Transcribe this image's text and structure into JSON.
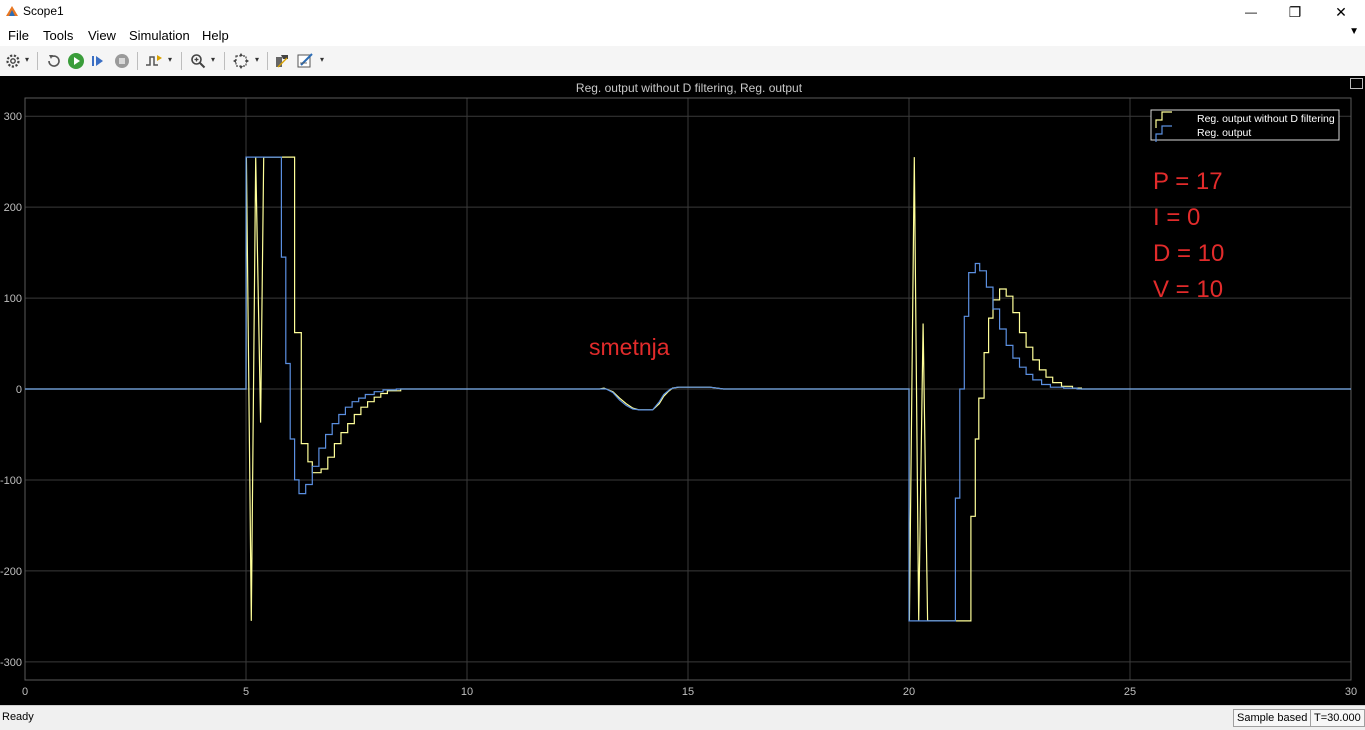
{
  "window": {
    "title": "Scope1",
    "minimize_glyph": "—",
    "maximize_glyph": "❐",
    "close_glyph": "✕"
  },
  "menu": {
    "items": [
      "File",
      "Tools",
      "View",
      "Simulation",
      "Help"
    ],
    "overflow_glyph": "▼"
  },
  "toolbar": {
    "buttons": [
      "settings-icon",
      "restore-icon",
      "run-icon",
      "step-forward-icon",
      "stop-icon",
      "triggers-icon",
      "zoom-in-icon",
      "fit-to-view-icon",
      "cursor-measurements-icon",
      "style-icon"
    ],
    "dropdown_glyph": "▾"
  },
  "scope": {
    "background": "#000000",
    "grid_color": "#3a3a3a",
    "axis_color": "#bfbfbf"
  },
  "chart_data": {
    "type": "line",
    "title": "Reg. output without D filtering, Reg. output",
    "xlabel": "",
    "ylabel": "",
    "xlim": [
      0,
      30
    ],
    "ylim": [
      -320,
      320
    ],
    "xticks": [
      0,
      5,
      10,
      15,
      20,
      25,
      30
    ],
    "yticks": [
      300,
      200,
      100,
      0,
      -100,
      -200,
      -300
    ],
    "grid": true,
    "legend_position": "top-right",
    "series": [
      {
        "name": "Reg. output without D filtering",
        "color": "#ffff99",
        "step": true,
        "points": [
          [
            0,
            0
          ],
          [
            5,
            0
          ],
          [
            5.01,
            255
          ],
          [
            5.12,
            -255
          ],
          [
            5.22,
            255
          ],
          [
            5.33,
            -37
          ],
          [
            5.4,
            255
          ],
          [
            6.1,
            255
          ],
          [
            6.1,
            62
          ],
          [
            6.25,
            62
          ],
          [
            6.25,
            -60
          ],
          [
            6.4,
            -60
          ],
          [
            6.4,
            -80
          ],
          [
            6.5,
            -80
          ],
          [
            6.5,
            -92
          ],
          [
            6.7,
            -92
          ],
          [
            6.7,
            -88
          ],
          [
            6.85,
            -88
          ],
          [
            6.85,
            -75
          ],
          [
            7,
            -75
          ],
          [
            7,
            -60
          ],
          [
            7.15,
            -60
          ],
          [
            7.15,
            -48
          ],
          [
            7.3,
            -48
          ],
          [
            7.3,
            -38
          ],
          [
            7.45,
            -38
          ],
          [
            7.45,
            -28
          ],
          [
            7.6,
            -28
          ],
          [
            7.6,
            -20
          ],
          [
            7.75,
            -20
          ],
          [
            7.75,
            -14
          ],
          [
            7.9,
            -14
          ],
          [
            7.9,
            -9
          ],
          [
            8.05,
            -9
          ],
          [
            8.05,
            -5
          ],
          [
            8.2,
            -5
          ],
          [
            8.2,
            -2
          ],
          [
            8.5,
            -2
          ],
          [
            8.5,
            0
          ],
          [
            13,
            0
          ],
          [
            13.1,
            1
          ],
          [
            13.3,
            -3
          ],
          [
            13.45,
            -10
          ],
          [
            13.6,
            -16
          ],
          [
            13.75,
            -21
          ],
          [
            13.9,
            -23
          ],
          [
            14.2,
            -23
          ],
          [
            14.35,
            -16
          ],
          [
            14.45,
            -8
          ],
          [
            14.55,
            -3
          ],
          [
            14.65,
            1
          ],
          [
            14.8,
            2
          ],
          [
            15.5,
            2
          ],
          [
            15.8,
            0
          ],
          [
            20,
            0
          ],
          [
            20.01,
            -255
          ],
          [
            20.12,
            255
          ],
          [
            20.22,
            -255
          ],
          [
            20.32,
            72
          ],
          [
            20.42,
            -255
          ],
          [
            21.4,
            -255
          ],
          [
            21.4,
            -140
          ],
          [
            21.5,
            -140
          ],
          [
            21.5,
            -55
          ],
          [
            21.58,
            -55
          ],
          [
            21.58,
            -10
          ],
          [
            21.7,
            -10
          ],
          [
            21.7,
            40
          ],
          [
            21.8,
            40
          ],
          [
            21.8,
            78
          ],
          [
            21.9,
            78
          ],
          [
            21.9,
            98
          ],
          [
            22.05,
            98
          ],
          [
            22.05,
            110
          ],
          [
            22.2,
            110
          ],
          [
            22.2,
            102
          ],
          [
            22.35,
            102
          ],
          [
            22.35,
            84
          ],
          [
            22.5,
            84
          ],
          [
            22.5,
            62
          ],
          [
            22.65,
            62
          ],
          [
            22.65,
            46
          ],
          [
            22.8,
            46
          ],
          [
            22.8,
            32
          ],
          [
            22.95,
            32
          ],
          [
            22.95,
            21
          ],
          [
            23.1,
            21
          ],
          [
            23.1,
            13
          ],
          [
            23.25,
            13
          ],
          [
            23.25,
            7
          ],
          [
            23.45,
            7
          ],
          [
            23.45,
            3
          ],
          [
            23.7,
            3
          ],
          [
            23.7,
            1
          ],
          [
            23.9,
            1
          ],
          [
            23.9,
            0
          ],
          [
            30,
            0
          ]
        ]
      },
      {
        "name": "Reg. output",
        "color": "#5b8fe0",
        "step": true,
        "points": [
          [
            0,
            0
          ],
          [
            5,
            0
          ],
          [
            5,
            255
          ],
          [
            5.8,
            255
          ],
          [
            5.8,
            145
          ],
          [
            5.9,
            145
          ],
          [
            5.9,
            28
          ],
          [
            6.0,
            28
          ],
          [
            6.0,
            -55
          ],
          [
            6.1,
            -55
          ],
          [
            6.1,
            -100
          ],
          [
            6.2,
            -100
          ],
          [
            6.2,
            -115
          ],
          [
            6.35,
            -115
          ],
          [
            6.35,
            -105
          ],
          [
            6.5,
            -105
          ],
          [
            6.5,
            -85
          ],
          [
            6.65,
            -85
          ],
          [
            6.65,
            -65
          ],
          [
            6.8,
            -65
          ],
          [
            6.8,
            -50
          ],
          [
            6.95,
            -50
          ],
          [
            6.95,
            -38
          ],
          [
            7.1,
            -38
          ],
          [
            7.1,
            -28
          ],
          [
            7.25,
            -28
          ],
          [
            7.25,
            -20
          ],
          [
            7.4,
            -20
          ],
          [
            7.4,
            -14
          ],
          [
            7.55,
            -14
          ],
          [
            7.55,
            -10
          ],
          [
            7.7,
            -10
          ],
          [
            7.7,
            -6
          ],
          [
            7.9,
            -6
          ],
          [
            7.9,
            -3
          ],
          [
            8.1,
            -3
          ],
          [
            8.1,
            -1
          ],
          [
            8.4,
            -1
          ],
          [
            8.4,
            0
          ],
          [
            13,
            0
          ],
          [
            13.15,
            0
          ],
          [
            13.3,
            -4
          ],
          [
            13.45,
            -12
          ],
          [
            13.6,
            -18
          ],
          [
            13.75,
            -22
          ],
          [
            13.9,
            -23
          ],
          [
            14.2,
            -23
          ],
          [
            14.35,
            -14
          ],
          [
            14.45,
            -6
          ],
          [
            14.6,
            0
          ],
          [
            14.75,
            2
          ],
          [
            15.5,
            2
          ],
          [
            15.8,
            0
          ],
          [
            20,
            0
          ],
          [
            20,
            -255
          ],
          [
            21.05,
            -255
          ],
          [
            21.05,
            -120
          ],
          [
            21.15,
            -120
          ],
          [
            21.15,
            0
          ],
          [
            21.25,
            0
          ],
          [
            21.25,
            80
          ],
          [
            21.35,
            80
          ],
          [
            21.35,
            128
          ],
          [
            21.5,
            128
          ],
          [
            21.5,
            138
          ],
          [
            21.6,
            138
          ],
          [
            21.6,
            130
          ],
          [
            21.75,
            130
          ],
          [
            21.75,
            112
          ],
          [
            21.9,
            112
          ],
          [
            21.9,
            88
          ],
          [
            22.05,
            88
          ],
          [
            22.05,
            66
          ],
          [
            22.2,
            66
          ],
          [
            22.2,
            48
          ],
          [
            22.35,
            48
          ],
          [
            22.35,
            34
          ],
          [
            22.5,
            34
          ],
          [
            22.5,
            24
          ],
          [
            22.65,
            24
          ],
          [
            22.65,
            16
          ],
          [
            22.8,
            16
          ],
          [
            22.8,
            10
          ],
          [
            23.0,
            10
          ],
          [
            23.0,
            5
          ],
          [
            23.2,
            5
          ],
          [
            23.2,
            2
          ],
          [
            23.5,
            2
          ],
          [
            23.5,
            1
          ],
          [
            23.8,
            1
          ],
          [
            23.8,
            0
          ],
          [
            30,
            0
          ]
        ]
      }
    ],
    "annotations": {
      "color": "#e22b2b",
      "pid_lines": [
        "P = 17",
        "I = 0",
        "D = 10",
        "V = 10"
      ],
      "disturbance_label": "smetnja"
    }
  },
  "status": {
    "left": "Ready",
    "sample": "Sample based",
    "time": "T=30.000"
  }
}
